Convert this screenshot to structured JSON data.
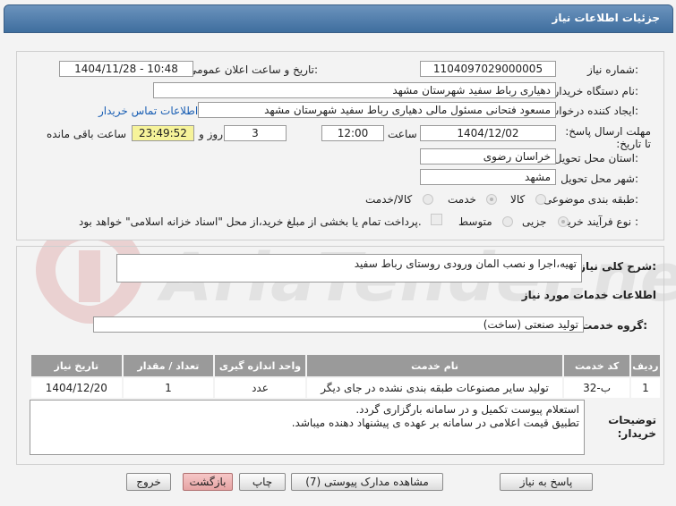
{
  "header": {
    "title": "جزئیات اطلاعات نیاز"
  },
  "watermark": {
    "text": "AriaTender.neT"
  },
  "form": {
    "need_number_label": "شماره نیاز:",
    "need_number": "1104097029000005",
    "announce_label": "تاریخ و ساعت اعلان عمومی:",
    "announce_value": "1404/11/28 - 10:48",
    "buyer_org_label": "نام دستگاه خریدار:",
    "buyer_org": "دهیاری رباط سفید شهرستان مشهد",
    "creator_label": "ایجاد کننده درخواست:",
    "creator": "مسعود فتحانی مسئول مالی دهیاری رباط سفید شهرستان مشهد",
    "contact_link": "اطلاعات تماس خریدار",
    "deadline_label": "مهلت ارسال پاسخ: تا تاریخ:",
    "deadline_date": "1404/12/02",
    "time_label": "ساعت",
    "deadline_time": "12:00",
    "days_value": "3",
    "days_label": "روز و",
    "remaining_time": "23:49:52",
    "remaining_label": "ساعت باقی مانده",
    "province_label": "استان محل تحویل:",
    "province": "خراسان رضوی",
    "city_label": "شهر محل تحویل:",
    "city": "مشهد",
    "category_label": "طبقه بندی موضوعی:",
    "category_options": [
      "کالا",
      "خدمت",
      "کالا/خدمت"
    ],
    "category_selected": "خدمت",
    "process_label": "نوع فرآیند خرید :",
    "process_options": [
      "جزیی",
      "متوسط"
    ],
    "process_selected": "جزیی",
    "payment_note": "پرداخت تمام یا بخشی از مبلغ خرید،از محل \"اسناد خزانه اسلامی\" خواهد بود."
  },
  "details": {
    "description_label": "شرح کلی نیاز:",
    "description": "تهیه،اجرا و نصب المان ورودی روستای رباط سفید",
    "services_heading": "اطلاعات خدمات مورد نیاز",
    "service_group_label": "گروه خدمت:",
    "service_group": "تولید صنعتی (ساخت)"
  },
  "table": {
    "headers": [
      "ردیف",
      "کد خدمت",
      "نام خدمت",
      "واحد اندازه گیری",
      "تعداد / مقدار",
      "تاریخ نیاز"
    ],
    "rows": [
      [
        "1",
        "ب-32",
        "تولید سایر مصنوعات طبقه بندی نشده در جای دیگر",
        "عدد",
        "1",
        "1404/12/20"
      ]
    ]
  },
  "buyer_notes": {
    "label": "توضیحات خریدار:",
    "line1": "استعلام پیوست تکمیل و در سامانه بارگزاری گردد.",
    "line2": "تطبیق قیمت اعلامی در سامانه بر عهده ی پیشنهاد دهنده میباشد."
  },
  "buttons": {
    "reply": "پاسخ به نیاز",
    "attachments": "مشاهده مدارک پیوستی (7)",
    "print": "چاپ",
    "back": "بازگشت",
    "exit": "خروج"
  },
  "colors": {
    "title_bar": "#4f7eab",
    "remaining_bg": "#f6f39a",
    "link": "#1a5fb4",
    "exit_bg": "#eab0b0"
  }
}
